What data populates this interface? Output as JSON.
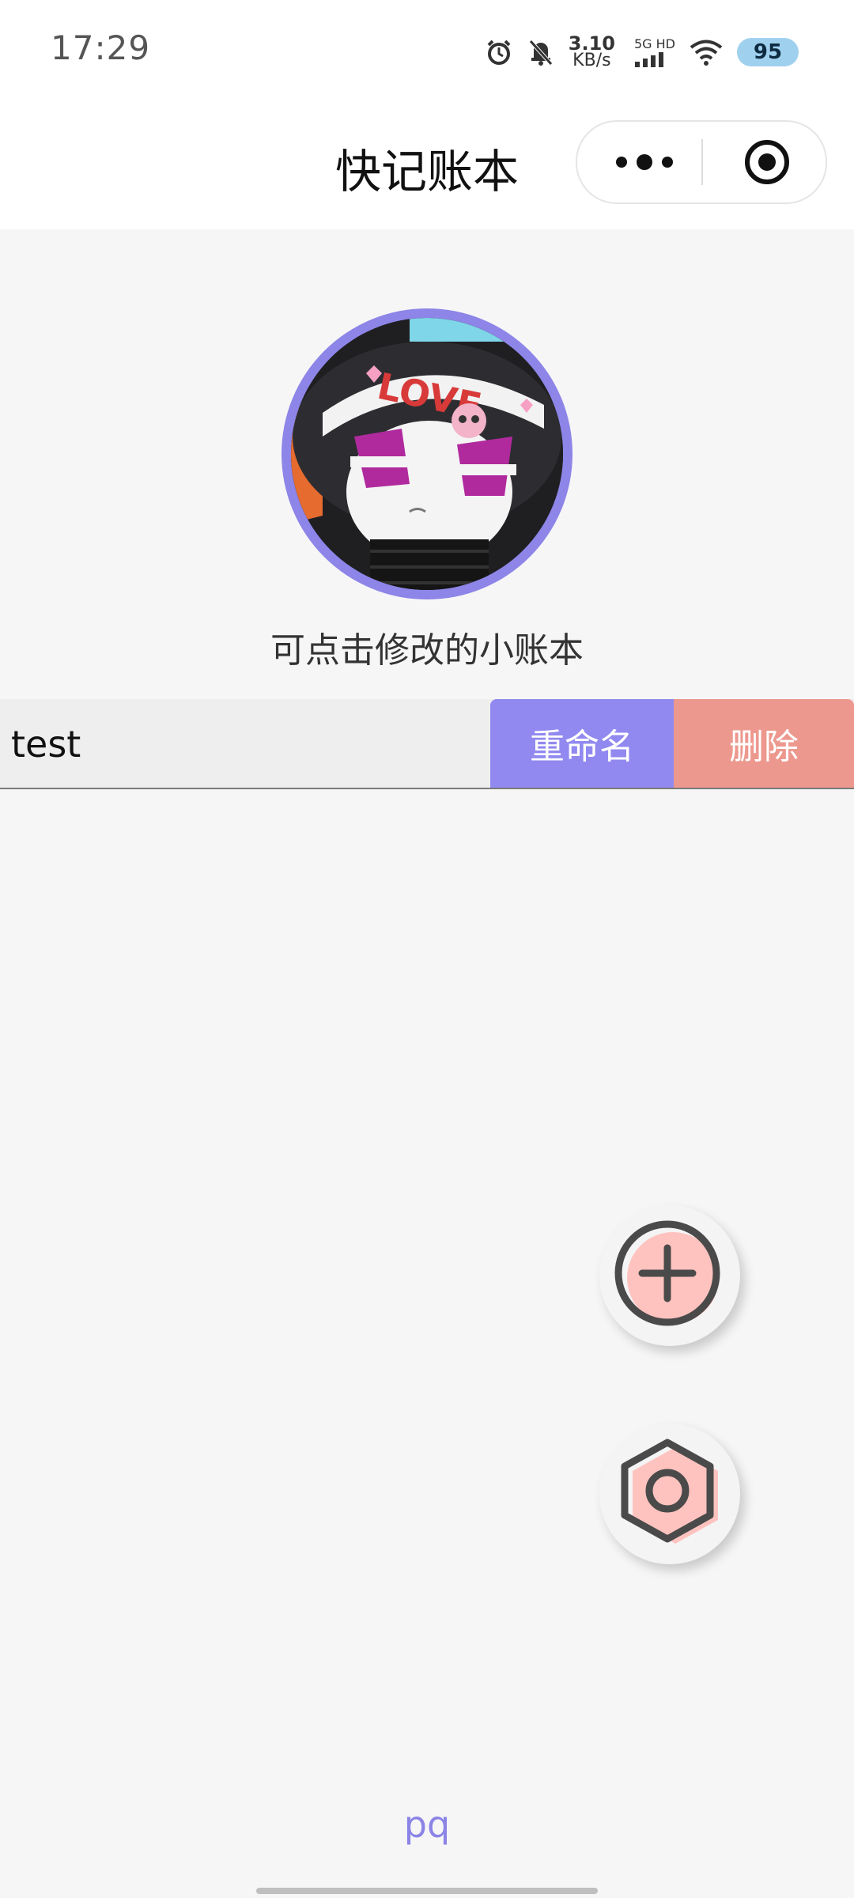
{
  "status_bar": {
    "time": "17:29",
    "net_speed_value": "3.10",
    "net_speed_unit": "KB/s",
    "network_label": "5G HD",
    "battery": "95"
  },
  "header": {
    "title": "快记账本"
  },
  "profile": {
    "subtitle": "可点击修改的小账本",
    "avatar_text": "LOVE"
  },
  "books": [
    {
      "name": "test",
      "rename_label": "重命名",
      "delete_label": "删除"
    }
  ],
  "footer": {
    "label": "pq"
  },
  "colors": {
    "accent": "#9189f0",
    "danger": "#ed988e",
    "background": "#f6f6f7"
  }
}
